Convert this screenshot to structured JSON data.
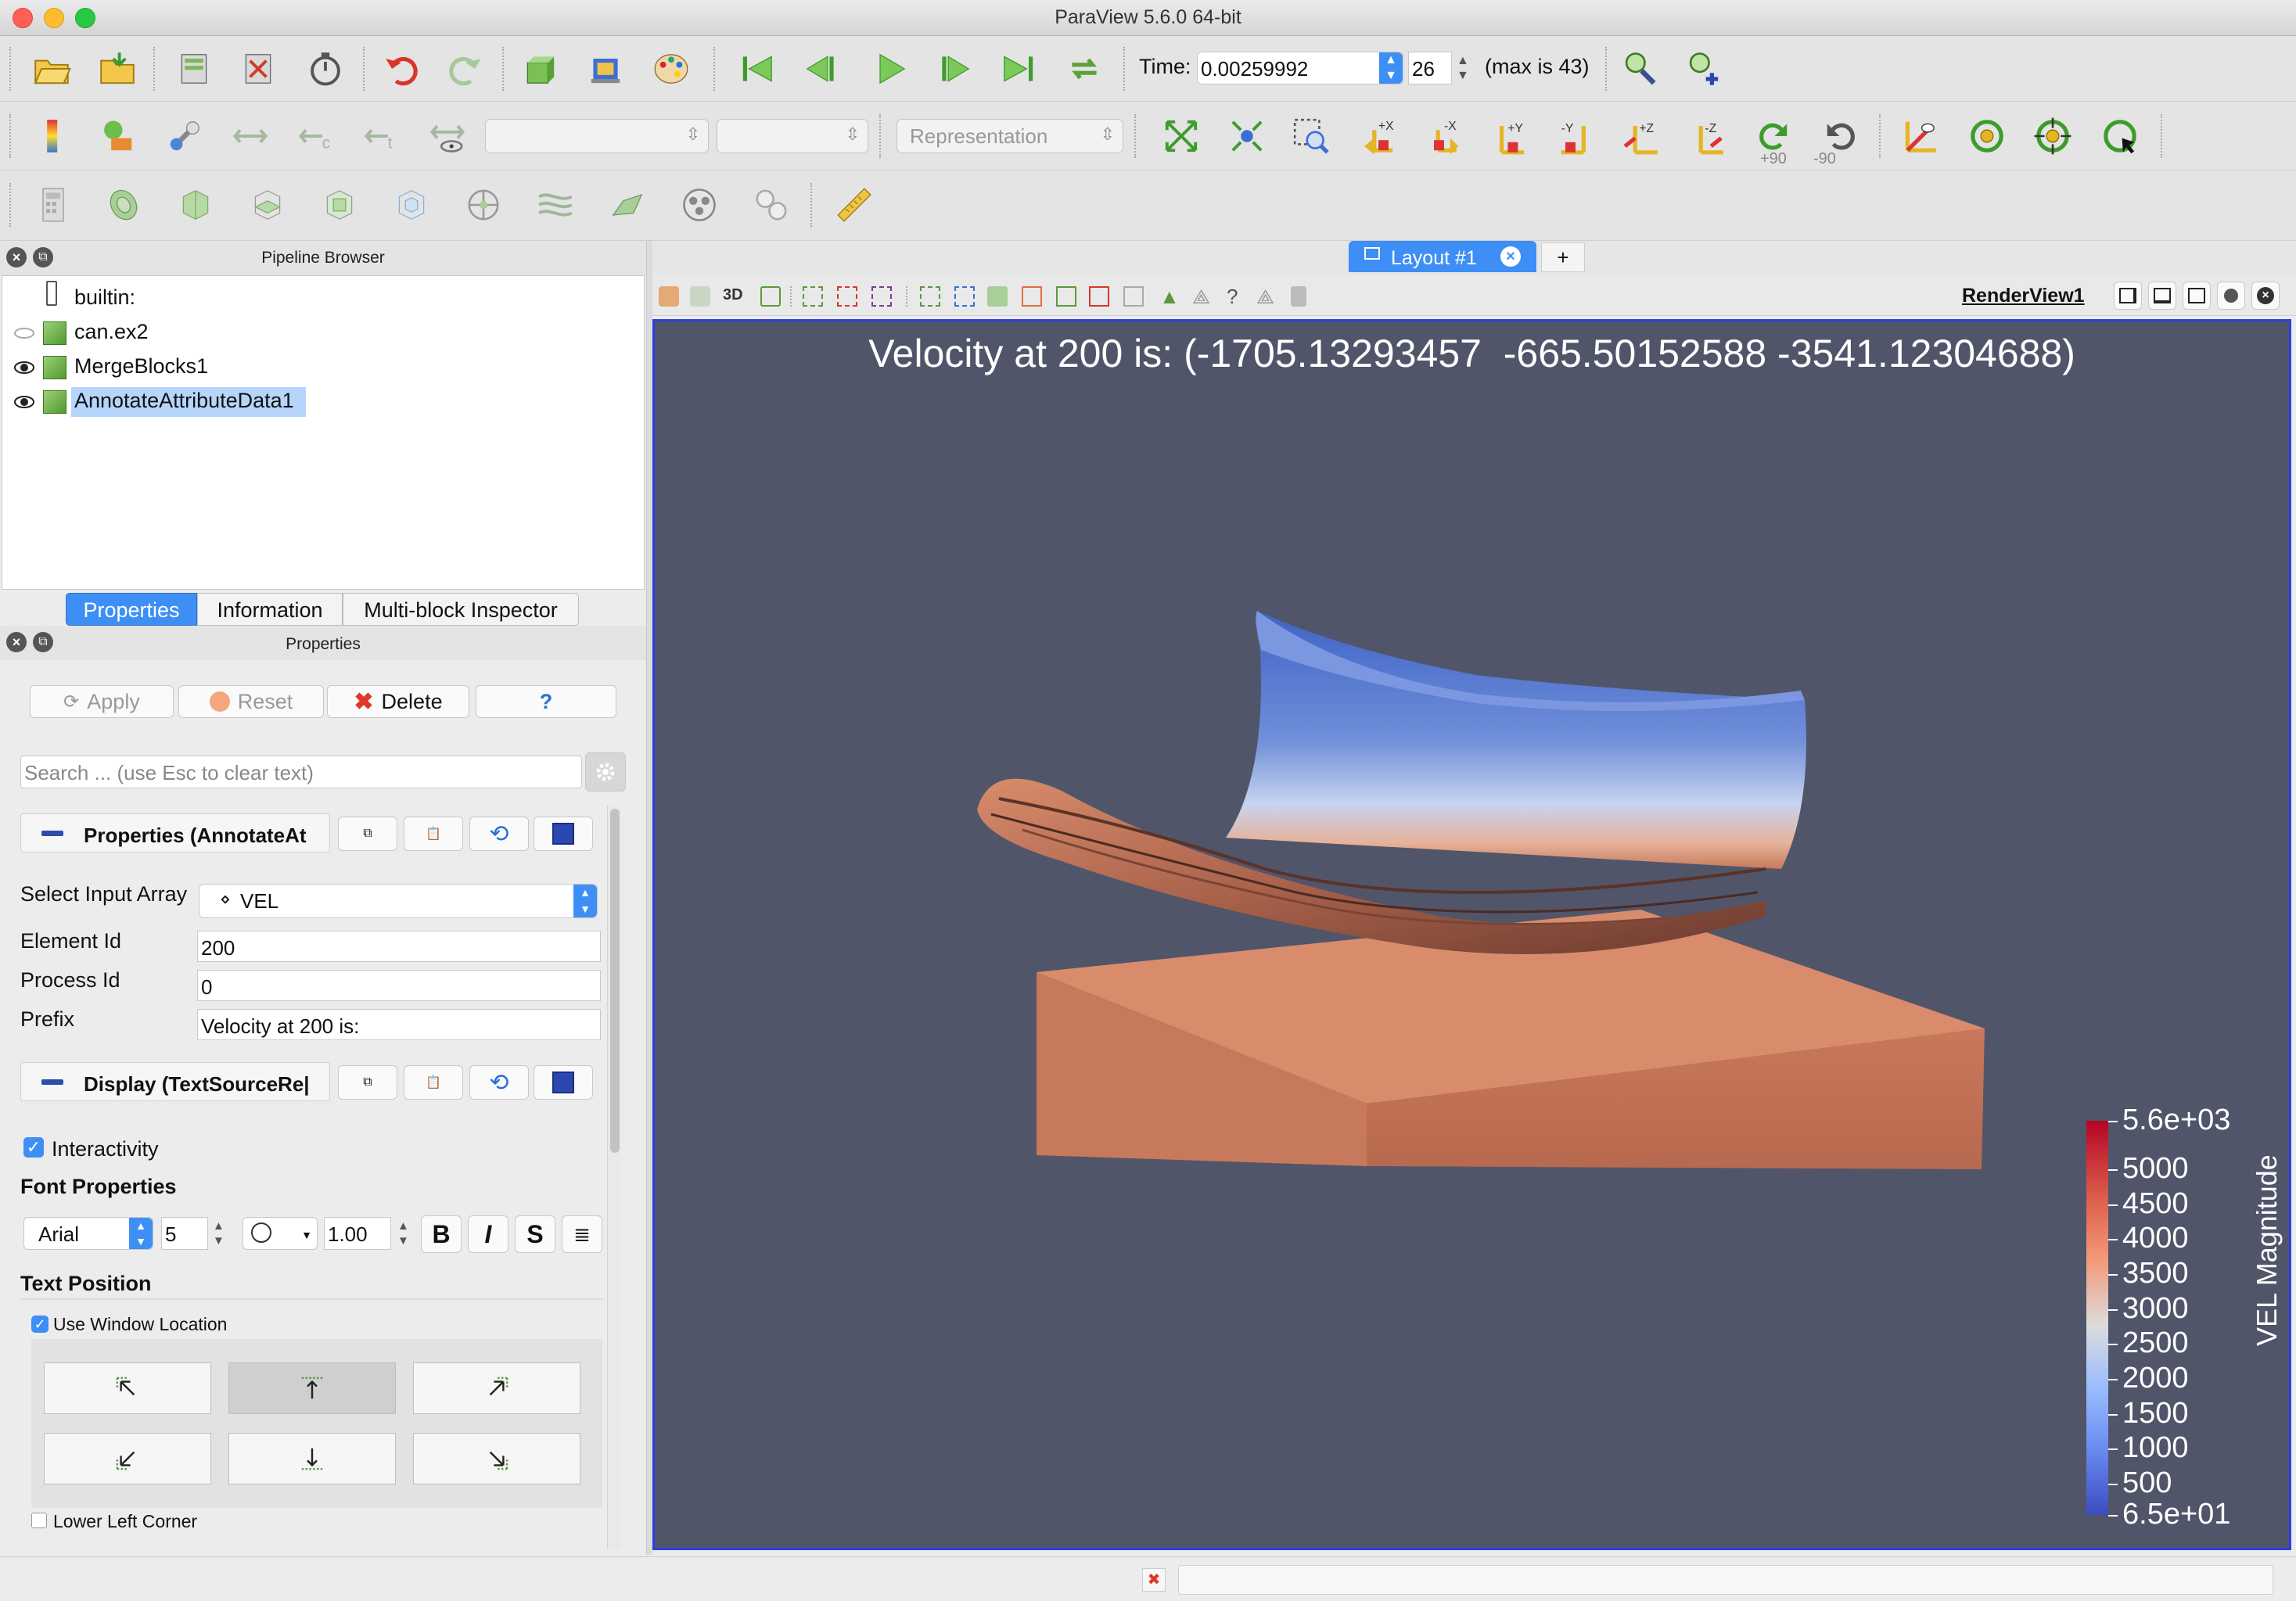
{
  "window": {
    "title": "ParaView 5.6.0 64-bit"
  },
  "toolbar": {
    "time_label": "Time:",
    "time_value": "0.00259992",
    "timestep_value": "26",
    "max_label": "(max is 43)",
    "representation_placeholder": "Representation",
    "view_buttons": [
      "+X",
      "-X",
      "+Y",
      "-Y",
      "+Z",
      "-Z",
      "+90",
      "-90"
    ]
  },
  "pipeline": {
    "title": "Pipeline Browser",
    "items": [
      {
        "label": "builtin:"
      },
      {
        "label": "can.ex2"
      },
      {
        "label": "MergeBlocks1"
      },
      {
        "label": "AnnotateAttributeData1",
        "selected": true
      }
    ]
  },
  "tabs": {
    "properties": "Properties",
    "information": "Information",
    "multiblock": "Multi-block Inspector"
  },
  "properties": {
    "title": "Properties",
    "apply": "Apply",
    "reset": "Reset",
    "delete": "Delete",
    "help": "?",
    "search_placeholder": "Search ... (use Esc to clear text)",
    "section_properties": "Properties (AnnotateAt",
    "select_input_array_label": "Select Input Array",
    "select_input_array_value": "VEL",
    "element_id_label": "Element Id",
    "element_id_value": "200",
    "process_id_label": "Process Id",
    "process_id_value": "0",
    "prefix_label": "Prefix",
    "prefix_value": "Velocity at 200 is:",
    "section_display": "Display (TextSourceRe|",
    "interactivity": "Interactivity",
    "font_properties": "Font Properties",
    "font_family": "Arial",
    "font_size": "5",
    "opacity": "1.00",
    "bold": "B",
    "italic": "I",
    "shadow": "S",
    "text_position": "Text Position",
    "use_window_location": "Use Window Location",
    "lower_left_corner": "Lower Left Corner"
  },
  "layout": {
    "tab_label": "Layout #1",
    "add_tab": "+",
    "view_name": "RenderView1",
    "mode_3d": "3D"
  },
  "render": {
    "annotation": "Velocity at 200 is: (-1705.13293457  -665.50152588 -3541.12304688)",
    "colorbar_title": "VEL Magnitude",
    "colorbar_ticks": [
      "5.6e+03",
      "5000",
      "4500",
      "4000",
      "3500",
      "3000",
      "2500",
      "2000",
      "1500",
      "1000",
      "500",
      "6.5e+01"
    ],
    "background_color": "#51556a"
  }
}
